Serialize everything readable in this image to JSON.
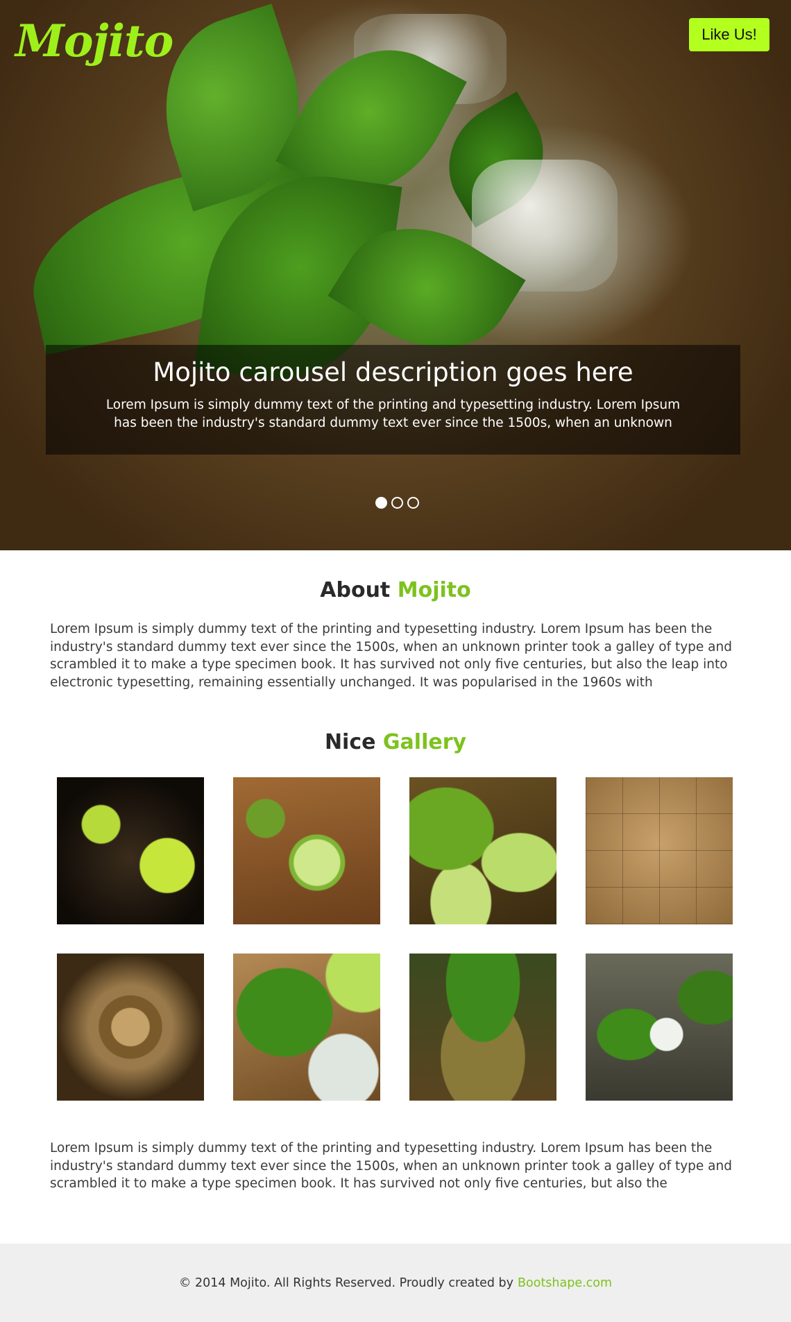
{
  "brand": {
    "logo_text": "Mojito",
    "accent_color": "#7dc21e",
    "logo_color": "#9ef01a"
  },
  "header": {
    "like_button_label": "Like Us!",
    "like_button_color": "#b3ff1e"
  },
  "carousel": {
    "title": "Mojito carousel description goes here",
    "text": "Lorem Ipsum is simply dummy text of the printing and typesetting industry. Lorem Ipsum has been the industry's standard dummy text ever since the 1500s, when an unknown prin-",
    "slide_count": 3,
    "active_slide": 1
  },
  "about": {
    "title_plain": "About",
    "title_accent": "Mojito",
    "text": "Lorem Ipsum is simply dummy text of the printing and typesetting industry. Lorem Ipsum has been the industry's standard dummy text ever since the 1500s, when an unknown printer took a galley of type and scrambled it to make a type specimen book. It has survived not only five centuries, but also the leap into electronic typesetting, remaining essentially unchanged. It was popularised in the 1960s with"
  },
  "gallery": {
    "title_plain": "Nice",
    "title_accent": "Gallery",
    "images": [
      "limes-on-plate",
      "cut-limes-on-board",
      "lime-wedges",
      "brown-sugar-cubes",
      "sugar-cubes-in-glass",
      "mint-and-lime-with-ice",
      "mint-glasses",
      "mojito-glass-pour"
    ]
  },
  "bottom": {
    "text": "Lorem Ipsum is simply dummy text of the printing and typesetting industry. Lorem Ipsum has been the industry's standard dummy text ever since the 1500s, when an unknown printer took a galley of type and scrambled it to make a type specimen book. It has survived not only five centuries, but also the"
  },
  "footer": {
    "copyright": "© 2014 Mojito. All Rights Reserved. Proudly created by",
    "link_text": "Bootshape.com"
  }
}
